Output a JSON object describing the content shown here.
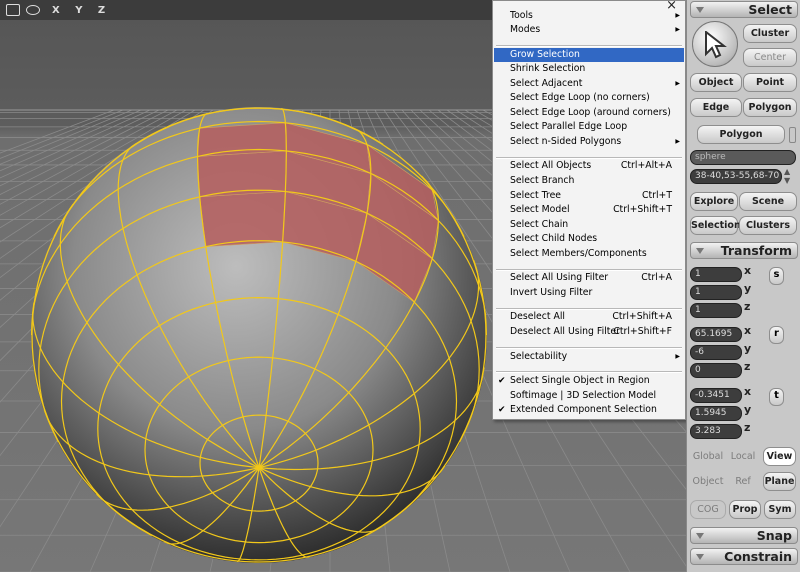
{
  "viewport": {
    "header_axes": "X Y Z"
  },
  "menu": {
    "close": "×",
    "items": [
      {
        "label": "Tools",
        "shortcut": "",
        "submenu": true
      },
      {
        "label": "Modes",
        "shortcut": "",
        "submenu": true
      },
      {
        "label": "Grow Selection",
        "shortcut": "",
        "highlighted": true
      },
      {
        "label": "Shrink Selection",
        "shortcut": ""
      },
      {
        "label": "Select Adjacent",
        "shortcut": "",
        "submenu": true
      },
      {
        "label": "Select Edge Loop (no corners)",
        "shortcut": ""
      },
      {
        "label": "Select Edge Loop (around corners)",
        "shortcut": ""
      },
      {
        "label": "Select Parallel Edge Loop",
        "shortcut": ""
      },
      {
        "label": "Select n-Sided Polygons",
        "shortcut": "",
        "submenu": true
      },
      {
        "label": "Select All Objects",
        "shortcut": "Ctrl+Alt+A"
      },
      {
        "label": "Select Branch",
        "shortcut": ""
      },
      {
        "label": "Select Tree",
        "shortcut": "Ctrl+T"
      },
      {
        "label": "Select Model",
        "shortcut": "Ctrl+Shift+T"
      },
      {
        "label": "Select Chain",
        "shortcut": ""
      },
      {
        "label": "Select Child Nodes",
        "shortcut": ""
      },
      {
        "label": "Select Members/Components",
        "shortcut": ""
      },
      {
        "label": "Select All Using Filter",
        "shortcut": "Ctrl+A"
      },
      {
        "label": "Invert Using Filter",
        "shortcut": ""
      },
      {
        "label": "Deselect All",
        "shortcut": "Ctrl+Shift+A"
      },
      {
        "label": "Deselect All Using Filter",
        "shortcut": "Ctrl+Shift+F"
      },
      {
        "label": "Selectability",
        "shortcut": "",
        "submenu": true
      },
      {
        "label": "Select Single Object in Region",
        "shortcut": "",
        "checked": true
      },
      {
        "label": "Softimage | 3D Selection Model",
        "shortcut": ""
      },
      {
        "label": "Extended Component Selection",
        "shortcut": "",
        "checked": true
      }
    ]
  },
  "panel": {
    "select_title": "Select",
    "cluster": "Cluster",
    "center": "Center",
    "object": "Object",
    "point": "Point",
    "edge": "Edge",
    "polygon": "Polygon",
    "polygon_mode": "Polygon",
    "selection_name": "sphere",
    "selection_indices": "38-40,53-55,68-70",
    "explore": "Explore",
    "scene": "Scene",
    "selection": "Selection",
    "clusters": "Clusters",
    "transform_title": "Transform",
    "scale": {
      "x": "1",
      "y": "1",
      "z": "1",
      "btn": "s"
    },
    "rotate": {
      "x": "65.1695",
      "y": "-6",
      "z": "0",
      "btn": "r"
    },
    "translate": {
      "x": "-0.3451",
      "y": "1.5945",
      "z": "3.283",
      "btn": "t"
    },
    "axis_x": "x",
    "axis_y": "y",
    "axis_z": "z",
    "global": "Global",
    "local": "Local",
    "view": "View",
    "object_ref": "Object",
    "ref": "Ref",
    "plane": "Plane",
    "cog": "COG",
    "prop": "Prop",
    "sym": "Sym",
    "snap_title": "Snap",
    "constrain_title": "Constrain"
  }
}
